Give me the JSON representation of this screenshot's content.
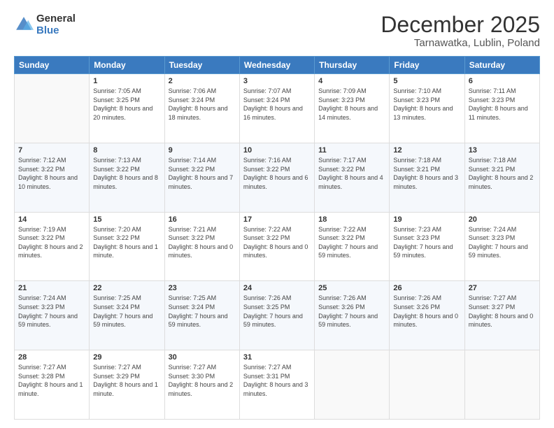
{
  "header": {
    "logo_line1": "General",
    "logo_line2": "Blue",
    "main_title": "December 2025",
    "subtitle": "Tarnawatka, Lublin, Poland"
  },
  "weekdays": [
    "Sunday",
    "Monday",
    "Tuesday",
    "Wednesday",
    "Thursday",
    "Friday",
    "Saturday"
  ],
  "weeks": [
    [
      {
        "day": "",
        "sunrise": "",
        "sunset": "",
        "daylight": ""
      },
      {
        "day": "1",
        "sunrise": "Sunrise: 7:05 AM",
        "sunset": "Sunset: 3:25 PM",
        "daylight": "Daylight: 8 hours and 20 minutes."
      },
      {
        "day": "2",
        "sunrise": "Sunrise: 7:06 AM",
        "sunset": "Sunset: 3:24 PM",
        "daylight": "Daylight: 8 hours and 18 minutes."
      },
      {
        "day": "3",
        "sunrise": "Sunrise: 7:07 AM",
        "sunset": "Sunset: 3:24 PM",
        "daylight": "Daylight: 8 hours and 16 minutes."
      },
      {
        "day": "4",
        "sunrise": "Sunrise: 7:09 AM",
        "sunset": "Sunset: 3:23 PM",
        "daylight": "Daylight: 8 hours and 14 minutes."
      },
      {
        "day": "5",
        "sunrise": "Sunrise: 7:10 AM",
        "sunset": "Sunset: 3:23 PM",
        "daylight": "Daylight: 8 hours and 13 minutes."
      },
      {
        "day": "6",
        "sunrise": "Sunrise: 7:11 AM",
        "sunset": "Sunset: 3:23 PM",
        "daylight": "Daylight: 8 hours and 11 minutes."
      }
    ],
    [
      {
        "day": "7",
        "sunrise": "Sunrise: 7:12 AM",
        "sunset": "Sunset: 3:22 PM",
        "daylight": "Daylight: 8 hours and 10 minutes."
      },
      {
        "day": "8",
        "sunrise": "Sunrise: 7:13 AM",
        "sunset": "Sunset: 3:22 PM",
        "daylight": "Daylight: 8 hours and 8 minutes."
      },
      {
        "day": "9",
        "sunrise": "Sunrise: 7:14 AM",
        "sunset": "Sunset: 3:22 PM",
        "daylight": "Daylight: 8 hours and 7 minutes."
      },
      {
        "day": "10",
        "sunrise": "Sunrise: 7:16 AM",
        "sunset": "Sunset: 3:22 PM",
        "daylight": "Daylight: 8 hours and 6 minutes."
      },
      {
        "day": "11",
        "sunrise": "Sunrise: 7:17 AM",
        "sunset": "Sunset: 3:22 PM",
        "daylight": "Daylight: 8 hours and 4 minutes."
      },
      {
        "day": "12",
        "sunrise": "Sunrise: 7:18 AM",
        "sunset": "Sunset: 3:21 PM",
        "daylight": "Daylight: 8 hours and 3 minutes."
      },
      {
        "day": "13",
        "sunrise": "Sunrise: 7:18 AM",
        "sunset": "Sunset: 3:21 PM",
        "daylight": "Daylight: 8 hours and 2 minutes."
      }
    ],
    [
      {
        "day": "14",
        "sunrise": "Sunrise: 7:19 AM",
        "sunset": "Sunset: 3:22 PM",
        "daylight": "Daylight: 8 hours and 2 minutes."
      },
      {
        "day": "15",
        "sunrise": "Sunrise: 7:20 AM",
        "sunset": "Sunset: 3:22 PM",
        "daylight": "Daylight: 8 hours and 1 minute."
      },
      {
        "day": "16",
        "sunrise": "Sunrise: 7:21 AM",
        "sunset": "Sunset: 3:22 PM",
        "daylight": "Daylight: 8 hours and 0 minutes."
      },
      {
        "day": "17",
        "sunrise": "Sunrise: 7:22 AM",
        "sunset": "Sunset: 3:22 PM",
        "daylight": "Daylight: 8 hours and 0 minutes."
      },
      {
        "day": "18",
        "sunrise": "Sunrise: 7:22 AM",
        "sunset": "Sunset: 3:22 PM",
        "daylight": "Daylight: 7 hours and 59 minutes."
      },
      {
        "day": "19",
        "sunrise": "Sunrise: 7:23 AM",
        "sunset": "Sunset: 3:23 PM",
        "daylight": "Daylight: 7 hours and 59 minutes."
      },
      {
        "day": "20",
        "sunrise": "Sunrise: 7:24 AM",
        "sunset": "Sunset: 3:23 PM",
        "daylight": "Daylight: 7 hours and 59 minutes."
      }
    ],
    [
      {
        "day": "21",
        "sunrise": "Sunrise: 7:24 AM",
        "sunset": "Sunset: 3:23 PM",
        "daylight": "Daylight: 7 hours and 59 minutes."
      },
      {
        "day": "22",
        "sunrise": "Sunrise: 7:25 AM",
        "sunset": "Sunset: 3:24 PM",
        "daylight": "Daylight: 7 hours and 59 minutes."
      },
      {
        "day": "23",
        "sunrise": "Sunrise: 7:25 AM",
        "sunset": "Sunset: 3:24 PM",
        "daylight": "Daylight: 7 hours and 59 minutes."
      },
      {
        "day": "24",
        "sunrise": "Sunrise: 7:26 AM",
        "sunset": "Sunset: 3:25 PM",
        "daylight": "Daylight: 7 hours and 59 minutes."
      },
      {
        "day": "25",
        "sunrise": "Sunrise: 7:26 AM",
        "sunset": "Sunset: 3:26 PM",
        "daylight": "Daylight: 7 hours and 59 minutes."
      },
      {
        "day": "26",
        "sunrise": "Sunrise: 7:26 AM",
        "sunset": "Sunset: 3:26 PM",
        "daylight": "Daylight: 8 hours and 0 minutes."
      },
      {
        "day": "27",
        "sunrise": "Sunrise: 7:27 AM",
        "sunset": "Sunset: 3:27 PM",
        "daylight": "Daylight: 8 hours and 0 minutes."
      }
    ],
    [
      {
        "day": "28",
        "sunrise": "Sunrise: 7:27 AM",
        "sunset": "Sunset: 3:28 PM",
        "daylight": "Daylight: 8 hours and 1 minute."
      },
      {
        "day": "29",
        "sunrise": "Sunrise: 7:27 AM",
        "sunset": "Sunset: 3:29 PM",
        "daylight": "Daylight: 8 hours and 1 minute."
      },
      {
        "day": "30",
        "sunrise": "Sunrise: 7:27 AM",
        "sunset": "Sunset: 3:30 PM",
        "daylight": "Daylight: 8 hours and 2 minutes."
      },
      {
        "day": "31",
        "sunrise": "Sunrise: 7:27 AM",
        "sunset": "Sunset: 3:31 PM",
        "daylight": "Daylight: 8 hours and 3 minutes."
      },
      {
        "day": "",
        "sunrise": "",
        "sunset": "",
        "daylight": ""
      },
      {
        "day": "",
        "sunrise": "",
        "sunset": "",
        "daylight": ""
      },
      {
        "day": "",
        "sunrise": "",
        "sunset": "",
        "daylight": ""
      }
    ]
  ]
}
